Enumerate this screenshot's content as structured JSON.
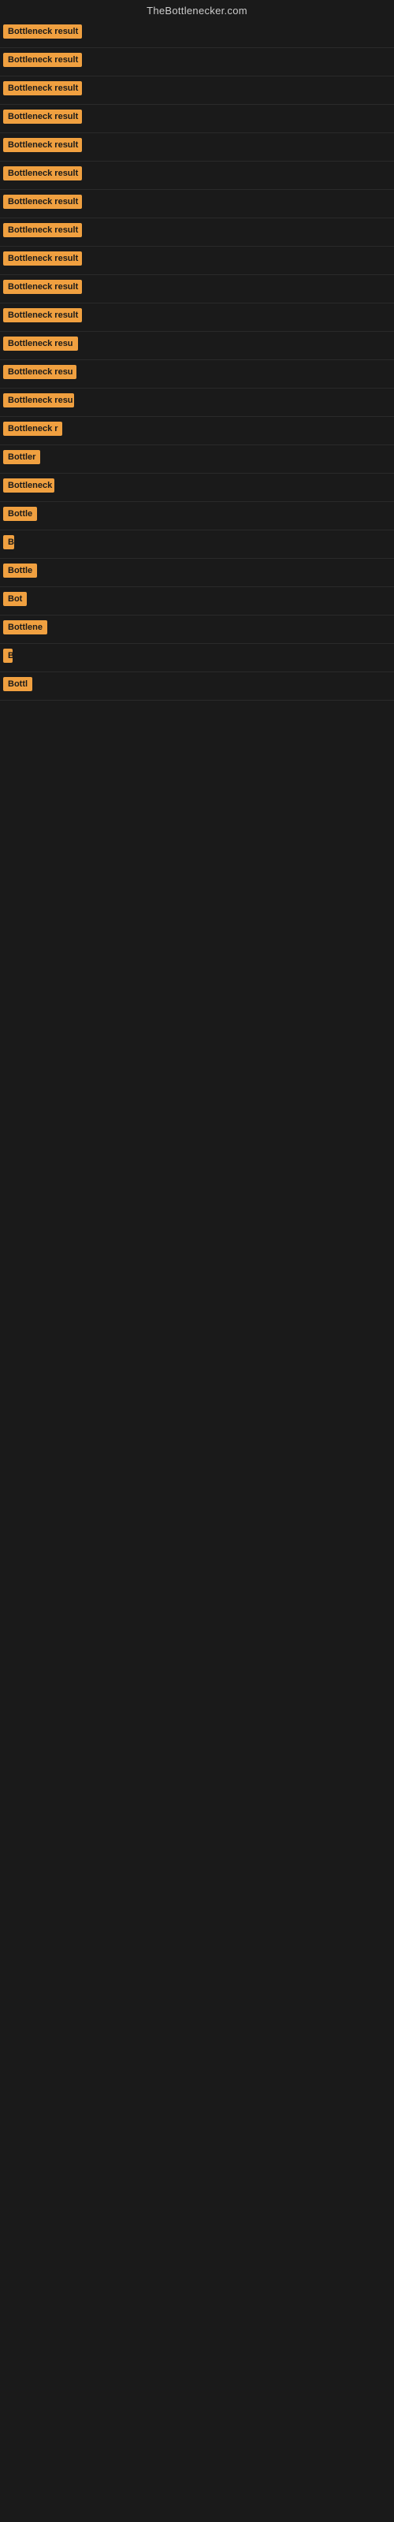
{
  "site": {
    "title": "TheBottlenecker.com"
  },
  "badges": [
    {
      "label": "Bottleneck result",
      "width": 100
    },
    {
      "label": "Bottleneck result",
      "width": 100
    },
    {
      "label": "Bottleneck result",
      "width": 100
    },
    {
      "label": "Bottleneck result",
      "width": 100
    },
    {
      "label": "Bottleneck result",
      "width": 100
    },
    {
      "label": "Bottleneck result",
      "width": 100
    },
    {
      "label": "Bottleneck result",
      "width": 100
    },
    {
      "label": "Bottleneck result",
      "width": 100
    },
    {
      "label": "Bottleneck result",
      "width": 100
    },
    {
      "label": "Bottleneck result",
      "width": 100
    },
    {
      "label": "Bottleneck result",
      "width": 100
    },
    {
      "label": "Bottleneck resu",
      "width": 95
    },
    {
      "label": "Bottleneck resu",
      "width": 93
    },
    {
      "label": "Bottleneck resu",
      "width": 90
    },
    {
      "label": "Bottleneck r",
      "width": 75
    },
    {
      "label": "Bottler",
      "width": 52
    },
    {
      "label": "Bottleneck",
      "width": 65
    },
    {
      "label": "Bottle",
      "width": 48
    },
    {
      "label": "B",
      "width": 14
    },
    {
      "label": "Bottle",
      "width": 48
    },
    {
      "label": "Bot",
      "width": 30
    },
    {
      "label": "Bottlene",
      "width": 58
    },
    {
      "label": "B",
      "width": 12
    },
    {
      "label": "Bottl",
      "width": 42
    }
  ]
}
